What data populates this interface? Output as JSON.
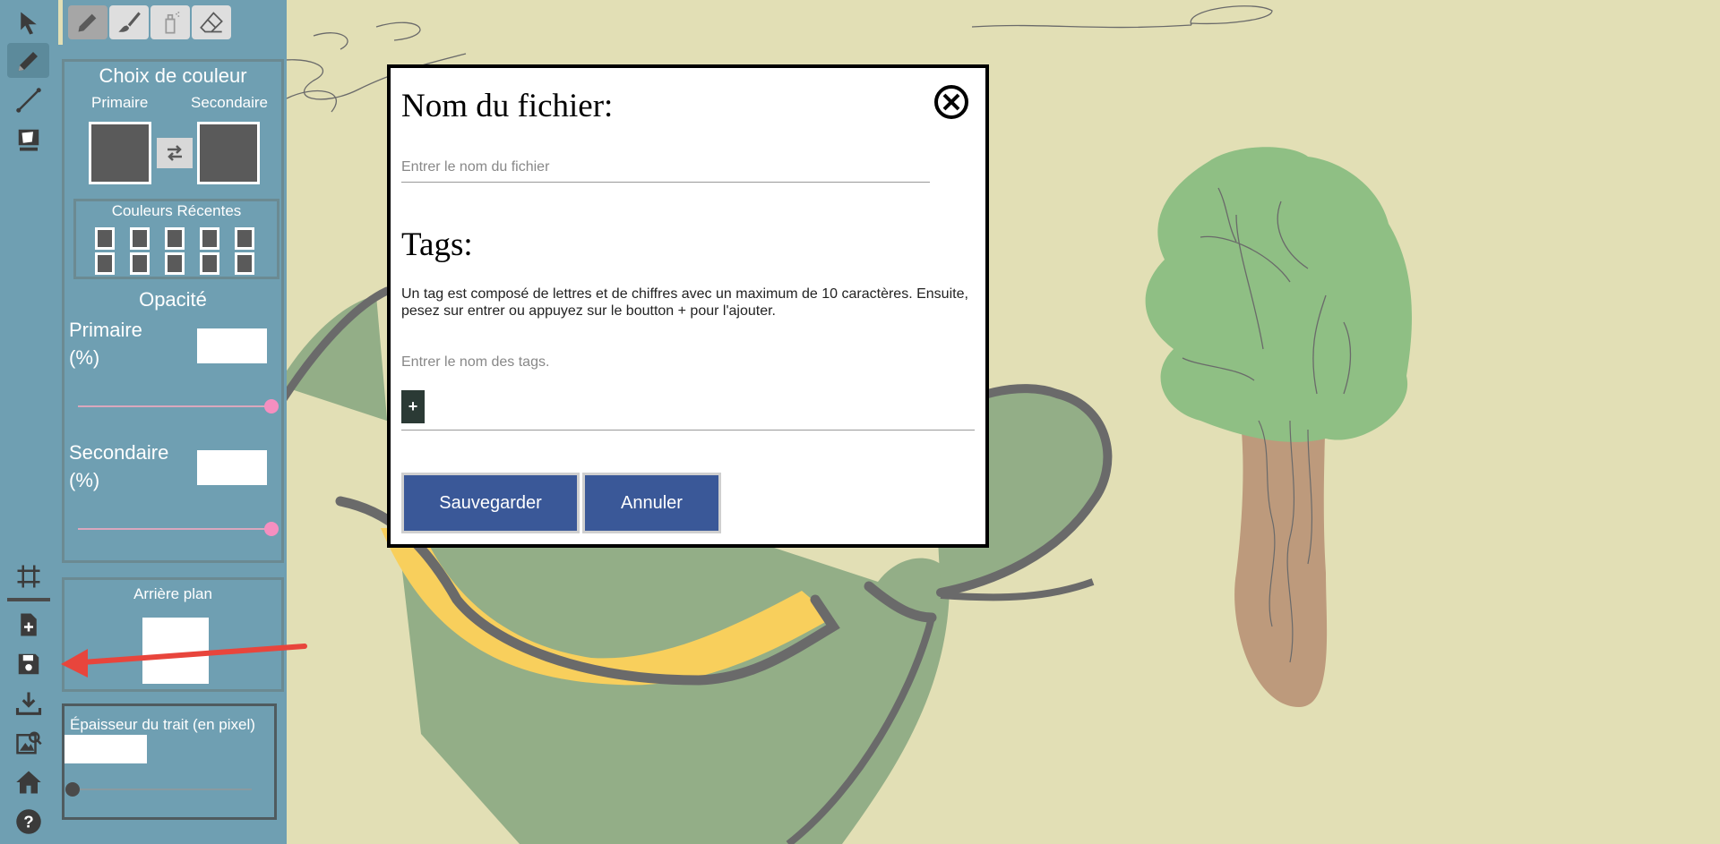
{
  "color_panel": {
    "title": "Choix de couleur",
    "primary_label": "Primaire",
    "secondary_label": "Secondaire",
    "recent_title": "Couleurs Récentes",
    "swatch_color": "#5a5a5a"
  },
  "opacity": {
    "title": "Opacité",
    "primary_label": "Primaire",
    "primary_unit": "(%)",
    "secondary_label": "Secondaire",
    "secondary_unit": "(%)",
    "primary_value": 1.0,
    "secondary_value": 1.0
  },
  "background": {
    "title": "Arrière plan"
  },
  "stroke": {
    "title": "Épaisseur du trait (en pixel)",
    "value": 0.0
  },
  "modal": {
    "filename_title": "Nom du fichier:",
    "filename_placeholder": "Entrer le nom du fichier",
    "tags_title": "Tags:",
    "tags_help": "Un tag est composé de lettres et de chiffres avec un maximum de 10 caractères. Ensuite, pesez sur entrer ou appuyez sur le boutton + pour l'ajouter.",
    "tags_placeholder": "Entrer le nom des tags.",
    "add_tag_label": "+",
    "save_label": "Sauvegarder",
    "cancel_label": "Annuler"
  },
  "toolbar": {
    "tools": [
      "select-icon",
      "pencil-icon",
      "line-icon",
      "fill-icon"
    ],
    "actions": [
      "grid-icon",
      "new-file-icon",
      "save-icon",
      "download-icon",
      "gallery-icon",
      "home-icon",
      "help-icon"
    ]
  },
  "colors": {
    "toolbar": "#6f9fb2",
    "canvas": "#e2dfb5",
    "modal_button": "#3a5898",
    "slider_knob": "#f58fc0",
    "annotation_arrow": "#e8453c"
  }
}
